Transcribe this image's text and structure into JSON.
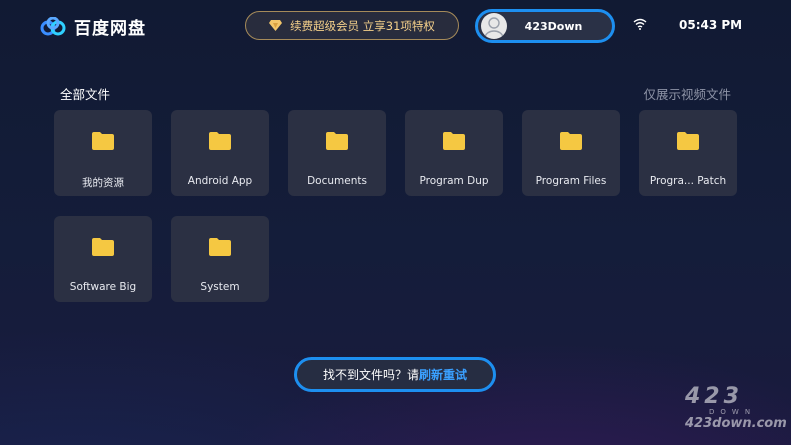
{
  "header": {
    "app_name": "百度网盘",
    "vip_label": "续费超级会员 立享31项特权",
    "user_name": "423Down",
    "time": "05:43 PM",
    "icons": [
      "cloud-logo-icon",
      "diamond-icon",
      "avatar-icon",
      "wifi-icon"
    ]
  },
  "main": {
    "section_title": "全部文件",
    "filter_label": "仅展示视频文件",
    "folders": [
      {
        "label": "我的资源"
      },
      {
        "label": "Android App"
      },
      {
        "label": "Documents"
      },
      {
        "label": "Program Dup"
      },
      {
        "label": "Program Files"
      },
      {
        "label": "Progra... Patch"
      },
      {
        "label": "Software Big"
      },
      {
        "label": "System"
      }
    ]
  },
  "footer": {
    "retry_prefix": "找不到文件吗？请",
    "retry_action": "刷新重试"
  },
  "watermark": {
    "big": "423",
    "small": "DOWN",
    "url": "423down.com"
  },
  "colors": {
    "accent": "#1d8ff0",
    "folder": "#f5c842",
    "vip_gold": "#f3cf8a"
  }
}
